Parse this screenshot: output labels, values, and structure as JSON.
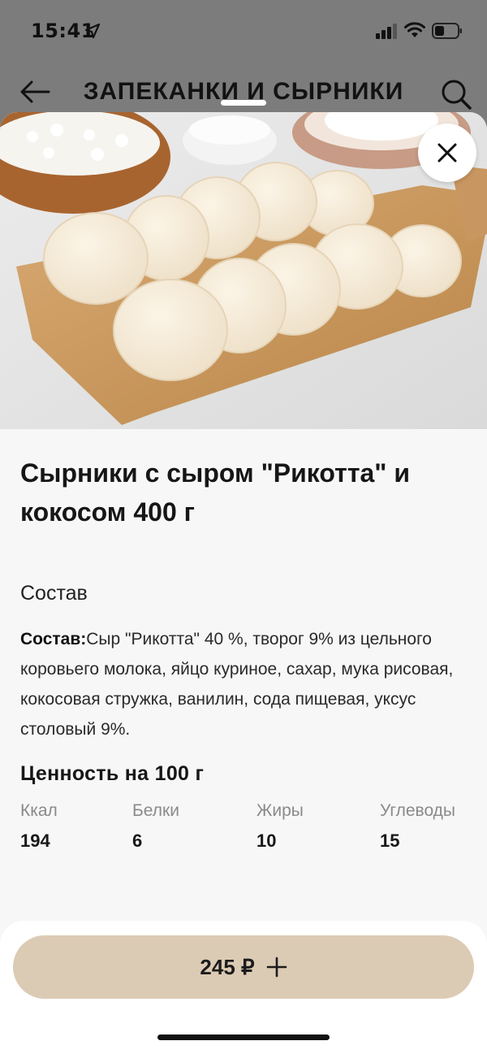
{
  "status_bar": {
    "time": "15:41"
  },
  "header": {
    "title": "ЗАПЕКАНКИ И СЫРНИКИ",
    "back_icon": "arrow-left-icon",
    "search_icon": "search-icon"
  },
  "product": {
    "title": "Сырники с сыром \"Рикотта\" и кокосом 400 г",
    "composition_heading": "Состав",
    "composition_label": "Состав:",
    "composition_text": "Сыр \"Рикотта\" 40 %, творог 9% из цельного коровьего молока, яйцо куриное, сахар, мука рисовая, кокосовая стружка, ванилин, сода пищевая, уксус столовый 9%.",
    "nutrition_heading": "Ценность на 100 г",
    "nutrition": [
      {
        "label": "Ккал",
        "value": "194"
      },
      {
        "label": "Белки",
        "value": "6"
      },
      {
        "label": "Жиры",
        "value": "10"
      },
      {
        "label": "Углеводы",
        "value": "15"
      }
    ]
  },
  "cart": {
    "price": "245 ₽"
  },
  "colors": {
    "accent": "#dccbb4",
    "background": "#f7f7f7",
    "dim_overlay": "#7c7c7c"
  }
}
